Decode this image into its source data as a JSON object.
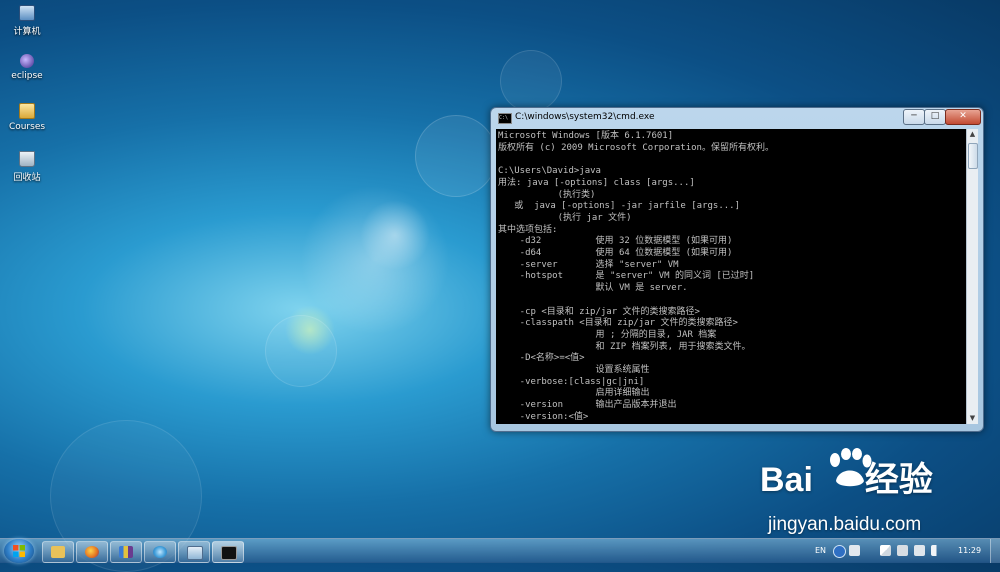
{
  "desktop": {
    "icons": [
      {
        "label": "计算机",
        "icon": "computer-icon"
      },
      {
        "label": "eclipse",
        "icon": "eclipse-icon"
      },
      {
        "label": "Courses",
        "icon": "folder-icon"
      },
      {
        "label": "回收站",
        "icon": "recycle-bin-icon"
      }
    ]
  },
  "cmd_window": {
    "title": "C:\\windows\\system32\\cmd.exe",
    "title_icon": "cmd-icon",
    "controls": {
      "minimize": "─",
      "maximize": "□",
      "close": "✕"
    },
    "scroll_up": "▲",
    "scroll_down": "▼",
    "console_text": "Microsoft Windows [版本 6.1.7601]\n版权所有 (c) 2009 Microsoft Corporation。保留所有权利。\n\nC:\\Users\\David>java\n用法: java [-options] class [args...]\n           (执行类)\n   或  java [-options] -jar jarfile [args...]\n           (执行 jar 文件)\n其中选项包括:\n    -d32          使用 32 位数据模型 (如果可用)\n    -d64          使用 64 位数据模型 (如果可用)\n    -server       选择 \"server\" VM\n    -hotspot      是 \"server\" VM 的同义词 [已过时]\n                  默认 VM 是 server.\n\n    -cp <目录和 zip/jar 文件的类搜索路径>\n    -classpath <目录和 zip/jar 文件的类搜索路径>\n                  用 ; 分隔的目录, JAR 档案\n                  和 ZIP 档案列表, 用于搜索类文件。\n    -D<名称>=<值>\n                  设置系统属性\n    -verbose:[class|gc|jni]\n                  启用详细输出\n    -version      输出产品版本并退出\n    -version:<值>"
  },
  "watermark": {
    "brand": "Bai",
    "brand_suffix": "经验",
    "url": "jingyan.baidu.com"
  },
  "taskbar": {
    "start_label": "Start",
    "pinned": [
      {
        "name": "explorer-icon",
        "color": "#e9c25a"
      },
      {
        "name": "firefox-icon",
        "color": "#e3701f"
      },
      {
        "name": "winrar-icon",
        "color": "#6a3b8f"
      },
      {
        "name": "ie-icon",
        "color": "#3c9bd8"
      },
      {
        "name": "network-icon",
        "color": "#8fb6d6"
      },
      {
        "name": "cmd-icon",
        "color": "#111111"
      }
    ],
    "tray": {
      "language": "EN",
      "clock": "11:29"
    }
  },
  "colors": {
    "accent": "#1670a8",
    "console_bg": "#000000",
    "console_fg": "#c0c0c0"
  }
}
